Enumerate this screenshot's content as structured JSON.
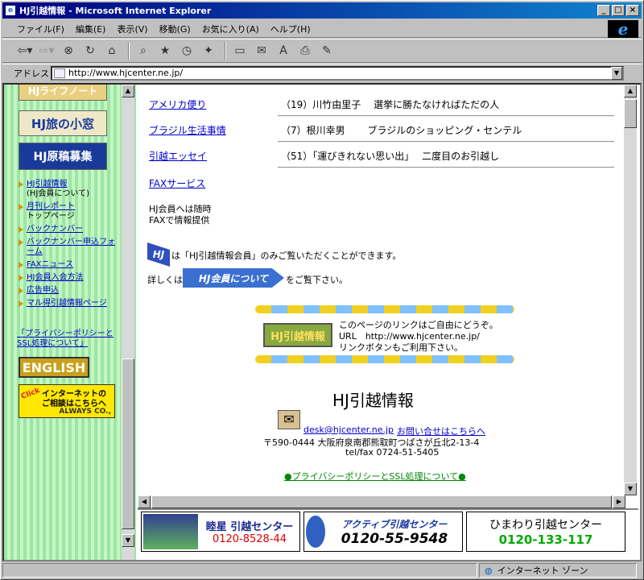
{
  "window": {
    "title": "HJ引越情報 - Microsoft Internet Explorer",
    "min": "_",
    "max": "□",
    "close": "×"
  },
  "menu": [
    "ファイル(F)",
    "編集(E)",
    "表示(V)",
    "移動(G)",
    "お気に入り(A)",
    "ヘルプ(H)"
  ],
  "address": {
    "label": "アドレス",
    "url": "http://www.hjcenter.ne.jp/"
  },
  "left": {
    "banners": [
      "HJライフノート",
      "HJ旅の小窓",
      "HJ原稿募集"
    ],
    "menu": [
      {
        "label": "HJ引越情報",
        "sub": "(HJ会員について)"
      },
      {
        "label": "月刊レポート",
        "sub": "トップページ"
      },
      {
        "label": "バックナンバー",
        "sub": ""
      },
      {
        "label": "バックナンバー申込フォーム",
        "sub": ""
      },
      {
        "label": "FAXニュース",
        "sub": ""
      },
      {
        "label": "HJ会員入会方法",
        "sub": ""
      },
      {
        "label": "広告申込",
        "sub": ""
      },
      {
        "label": "マル得引越情報ページ",
        "sub": ""
      }
    ],
    "privacy": "「プライバシーポリシーとSSL処理について」",
    "english": "ENGLISH",
    "click_ad": {
      "line1": "インターネットの",
      "line2": "ご相談はこちらへ",
      "click": "Click",
      "company": "ALWAYS CO.,"
    }
  },
  "main": {
    "rows": [
      {
        "link": "アメリカ便り",
        "text": "（19）川竹由里子　 選挙に勝たなければただの人"
      },
      {
        "link": "ブラジル生活事情",
        "text": "（7）根川幸男　　 ブラジルのショッピング・センテル"
      },
      {
        "link": "引越エッセイ",
        "text": "（51）「運びきれない思い出」　 二度目のお引越し"
      }
    ],
    "fax_link": "FAXサービス",
    "fax_text1": "HJ会員へは随時",
    "fax_text2": "FAXで情報提供",
    "member_badge": "HJ",
    "member_note": "は「HJ引越情報会員」のみご覧いただくことができます。",
    "detail_prefix": "詳しくは",
    "detail_button": "HJ会員について",
    "detail_suffix": "をご覧下さい。",
    "link_logo": "HJ引越情報",
    "link_text1": "このページのリンクはご自由にどうぞ。",
    "link_text2": "URL　http://www.hjcenter.ne.jp/",
    "link_text3": "リンクボタンもご利用下さい。",
    "site_title": "HJ引越情報",
    "email": "desk@hjcenter.ne.jp",
    "contact": "お問い合せはこちらへ",
    "postal": "〒590-0444 大阪府泉南郡熊取町つばさが丘北2-13-4",
    "tel": "tel/fax 0724-51-5405",
    "privacy": "●プライバシーポリシーとSSL処理について●"
  },
  "ads": [
    {
      "name": "睦星 引越センター",
      "phone": "0120-8528-44"
    },
    {
      "name": "アクティブ引越センター",
      "phone": "0120-55-9548"
    },
    {
      "name": "ひまわり引越センター",
      "phone": "0120-133-117"
    }
  ],
  "status": {
    "zone": "インターネット ゾーン"
  }
}
